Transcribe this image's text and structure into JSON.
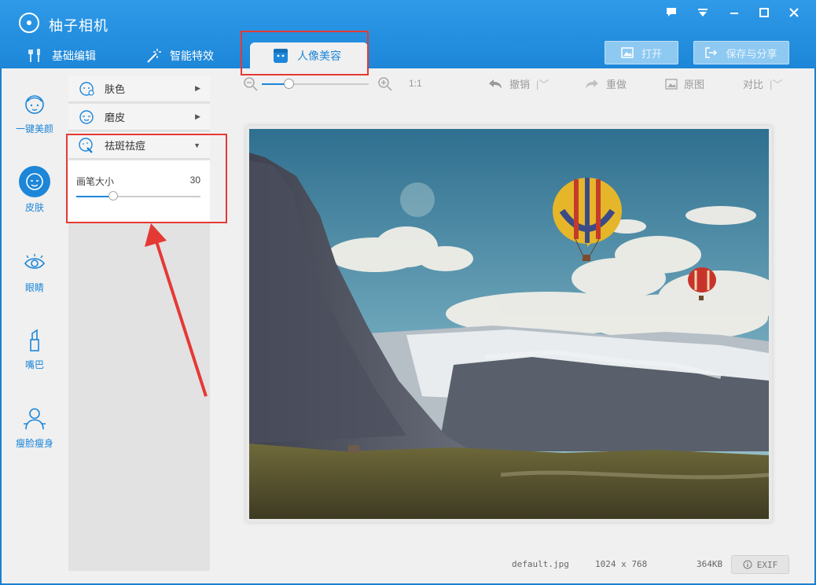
{
  "window": {
    "title": "柚子相机"
  },
  "tabs": [
    {
      "label": "基础编辑",
      "icon": "brush-tools-icon"
    },
    {
      "label": "智能特效",
      "icon": "magic-wand-icon"
    },
    {
      "label": "人像美容",
      "icon": "face-box-icon",
      "active": true
    }
  ],
  "toolbar": {
    "open_label": "打开",
    "save_share_label": "保存与分享"
  },
  "leftnav": [
    {
      "label": "一键美颜",
      "icon": "beauty-face-icon"
    },
    {
      "label": "皮肤",
      "icon": "skin-face-icon",
      "active": true
    },
    {
      "label": "眼睛",
      "icon": "eye-icon"
    },
    {
      "label": "嘴巴",
      "icon": "lipstick-icon"
    },
    {
      "label": "瘦脸瘦身",
      "icon": "body-slim-icon"
    }
  ],
  "panel": {
    "items": [
      {
        "label": "肤色",
        "expanded": false
      },
      {
        "label": "磨皮",
        "expanded": false
      },
      {
        "label": "祛斑祛痘",
        "expanded": true
      }
    ],
    "brush": {
      "label": "画笔大小",
      "value": "30",
      "fraction": 0.3
    }
  },
  "canvas_toolbar": {
    "zoom_fraction": 0.25,
    "ratio": "1:1",
    "undo": "撤销",
    "redo": "重做",
    "original": "原图",
    "compare": "对比"
  },
  "status": {
    "filename": "default.jpg",
    "dimensions": "1024 x 768",
    "filesize": "364KB",
    "exif": "EXIF"
  },
  "colors": {
    "accent": "#1d86d8",
    "highlight": "#e53935"
  }
}
